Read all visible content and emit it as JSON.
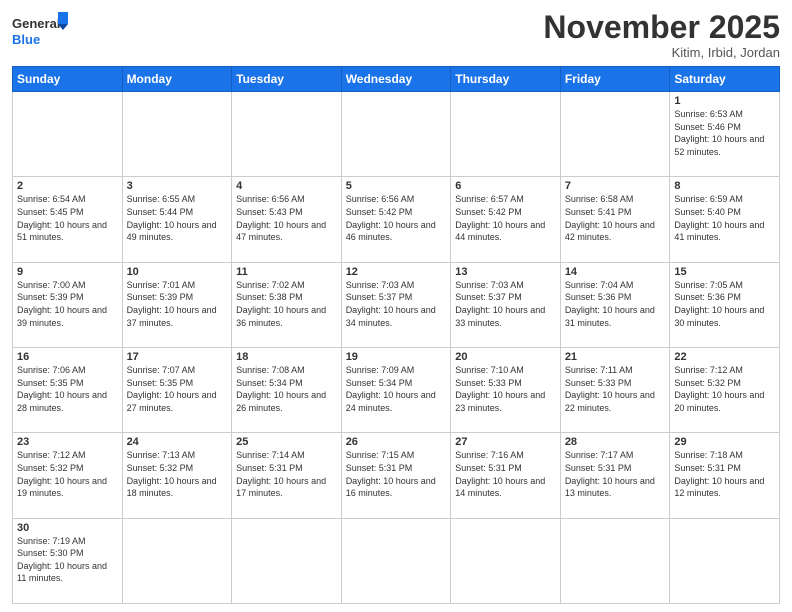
{
  "header": {
    "logo_general": "General",
    "logo_blue": "Blue",
    "month_title": "November 2025",
    "location": "Kitim, Irbid, Jordan"
  },
  "days_of_week": [
    "Sunday",
    "Monday",
    "Tuesday",
    "Wednesday",
    "Thursday",
    "Friday",
    "Saturday"
  ],
  "weeks": [
    [
      {
        "day": "",
        "empty": true
      },
      {
        "day": "",
        "empty": true
      },
      {
        "day": "",
        "empty": true
      },
      {
        "day": "",
        "empty": true
      },
      {
        "day": "",
        "empty": true
      },
      {
        "day": "",
        "empty": true
      },
      {
        "day": "1",
        "sunrise": "6:53 AM",
        "sunset": "5:46 PM",
        "daylight": "10 hours and 52 minutes."
      }
    ],
    [
      {
        "day": "2",
        "sunrise": "6:54 AM",
        "sunset": "5:45 PM",
        "daylight": "10 hours and 51 minutes."
      },
      {
        "day": "3",
        "sunrise": "6:55 AM",
        "sunset": "5:44 PM",
        "daylight": "10 hours and 49 minutes."
      },
      {
        "day": "4",
        "sunrise": "6:56 AM",
        "sunset": "5:43 PM",
        "daylight": "10 hours and 47 minutes."
      },
      {
        "day": "5",
        "sunrise": "6:56 AM",
        "sunset": "5:42 PM",
        "daylight": "10 hours and 46 minutes."
      },
      {
        "day": "6",
        "sunrise": "6:57 AM",
        "sunset": "5:42 PM",
        "daylight": "10 hours and 44 minutes."
      },
      {
        "day": "7",
        "sunrise": "6:58 AM",
        "sunset": "5:41 PM",
        "daylight": "10 hours and 42 minutes."
      },
      {
        "day": "8",
        "sunrise": "6:59 AM",
        "sunset": "5:40 PM",
        "daylight": "10 hours and 41 minutes."
      }
    ],
    [
      {
        "day": "9",
        "sunrise": "7:00 AM",
        "sunset": "5:39 PM",
        "daylight": "10 hours and 39 minutes."
      },
      {
        "day": "10",
        "sunrise": "7:01 AM",
        "sunset": "5:39 PM",
        "daylight": "10 hours and 37 minutes."
      },
      {
        "day": "11",
        "sunrise": "7:02 AM",
        "sunset": "5:38 PM",
        "daylight": "10 hours and 36 minutes."
      },
      {
        "day": "12",
        "sunrise": "7:03 AM",
        "sunset": "5:37 PM",
        "daylight": "10 hours and 34 minutes."
      },
      {
        "day": "13",
        "sunrise": "7:03 AM",
        "sunset": "5:37 PM",
        "daylight": "10 hours and 33 minutes."
      },
      {
        "day": "14",
        "sunrise": "7:04 AM",
        "sunset": "5:36 PM",
        "daylight": "10 hours and 31 minutes."
      },
      {
        "day": "15",
        "sunrise": "7:05 AM",
        "sunset": "5:36 PM",
        "daylight": "10 hours and 30 minutes."
      }
    ],
    [
      {
        "day": "16",
        "sunrise": "7:06 AM",
        "sunset": "5:35 PM",
        "daylight": "10 hours and 28 minutes."
      },
      {
        "day": "17",
        "sunrise": "7:07 AM",
        "sunset": "5:35 PM",
        "daylight": "10 hours and 27 minutes."
      },
      {
        "day": "18",
        "sunrise": "7:08 AM",
        "sunset": "5:34 PM",
        "daylight": "10 hours and 26 minutes."
      },
      {
        "day": "19",
        "sunrise": "7:09 AM",
        "sunset": "5:34 PM",
        "daylight": "10 hours and 24 minutes."
      },
      {
        "day": "20",
        "sunrise": "7:10 AM",
        "sunset": "5:33 PM",
        "daylight": "10 hours and 23 minutes."
      },
      {
        "day": "21",
        "sunrise": "7:11 AM",
        "sunset": "5:33 PM",
        "daylight": "10 hours and 22 minutes."
      },
      {
        "day": "22",
        "sunrise": "7:12 AM",
        "sunset": "5:32 PM",
        "daylight": "10 hours and 20 minutes."
      }
    ],
    [
      {
        "day": "23",
        "sunrise": "7:12 AM",
        "sunset": "5:32 PM",
        "daylight": "10 hours and 19 minutes."
      },
      {
        "day": "24",
        "sunrise": "7:13 AM",
        "sunset": "5:32 PM",
        "daylight": "10 hours and 18 minutes."
      },
      {
        "day": "25",
        "sunrise": "7:14 AM",
        "sunset": "5:31 PM",
        "daylight": "10 hours and 17 minutes."
      },
      {
        "day": "26",
        "sunrise": "7:15 AM",
        "sunset": "5:31 PM",
        "daylight": "10 hours and 16 minutes."
      },
      {
        "day": "27",
        "sunrise": "7:16 AM",
        "sunset": "5:31 PM",
        "daylight": "10 hours and 14 minutes."
      },
      {
        "day": "28",
        "sunrise": "7:17 AM",
        "sunset": "5:31 PM",
        "daylight": "10 hours and 13 minutes."
      },
      {
        "day": "29",
        "sunrise": "7:18 AM",
        "sunset": "5:31 PM",
        "daylight": "10 hours and 12 minutes."
      }
    ],
    [
      {
        "day": "30",
        "sunrise": "7:19 AM",
        "sunset": "5:30 PM",
        "daylight": "10 hours and 11 minutes."
      },
      {
        "day": "",
        "empty": true
      },
      {
        "day": "",
        "empty": true
      },
      {
        "day": "",
        "empty": true
      },
      {
        "day": "",
        "empty": true
      },
      {
        "day": "",
        "empty": true
      },
      {
        "day": "",
        "empty": true
      }
    ]
  ]
}
